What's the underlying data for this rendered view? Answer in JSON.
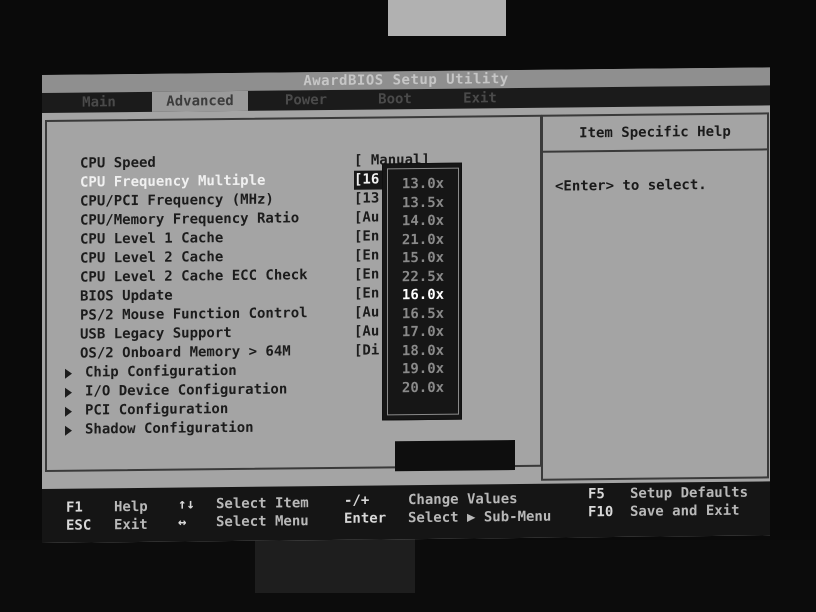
{
  "window": {
    "title": "AwardBIOS Setup Utility"
  },
  "menu": [
    {
      "label": "Main"
    },
    {
      "label": "Advanced"
    },
    {
      "label": "Power"
    },
    {
      "label": "Boot"
    },
    {
      "label": "Exit"
    }
  ],
  "settings": [
    {
      "label": "CPU Speed",
      "value": "[ Manual]"
    },
    {
      "label": "CPU Frequency Multiple",
      "value": "[16"
    },
    {
      "label": "CPU/PCI Frequency (MHz)",
      "value": "[13"
    },
    {
      "label": "CPU/Memory Frequency Ratio",
      "value": "[Au"
    },
    {
      "label": "CPU Level 1 Cache",
      "value": "[En"
    },
    {
      "label": "CPU Level 2 Cache",
      "value": "[En"
    },
    {
      "label": "CPU Level 2 Cache ECC Check",
      "value": "[En"
    },
    {
      "label": "BIOS Update",
      "value": "[En"
    },
    {
      "label": "PS/2 Mouse Function Control",
      "value": "[Au"
    },
    {
      "label": "USB Legacy Support",
      "value": "[Au"
    },
    {
      "label": "OS/2 Onboard Memory > 64M",
      "value": "[Di"
    }
  ],
  "submenus": [
    {
      "label": "Chip Configuration"
    },
    {
      "label": "I/O Device Configuration"
    },
    {
      "label": "PCI Configuration"
    },
    {
      "label": "Shadow Configuration"
    }
  ],
  "popup": {
    "options": [
      "13.0x",
      "13.5x",
      "14.0x",
      "21.0x",
      "15.0x",
      "22.5x",
      "16.0x",
      "16.5x",
      "17.0x",
      "18.0x",
      "19.0x",
      "20.0x"
    ],
    "selected": "16.0x"
  },
  "help": {
    "title": "Item Specific Help",
    "text": "<Enter> to select."
  },
  "footer": {
    "f1_key": "F1",
    "f1_desc": "Help",
    "esc_key": "ESC",
    "esc_desc": "Exit",
    "updown_key": "↑↓",
    "updown_desc": "Select Item",
    "leftright_key": "↔",
    "leftright_desc": "Select Menu",
    "plusminus_key": "-/+",
    "plusminus_desc": "Change Values",
    "enter_key": "Enter",
    "enter_desc": "Select ▶ Sub-Menu",
    "f5_key": "F5",
    "f5_desc": "Setup Defaults",
    "f10_key": "F10",
    "f10_desc": "Save and Exit"
  },
  "colors": {
    "screen_bg": "#a4a4a4",
    "bar_bg": "#1b1b1b",
    "text_dark": "#1c1c1c",
    "text_highlight": "#f0f0f0"
  }
}
